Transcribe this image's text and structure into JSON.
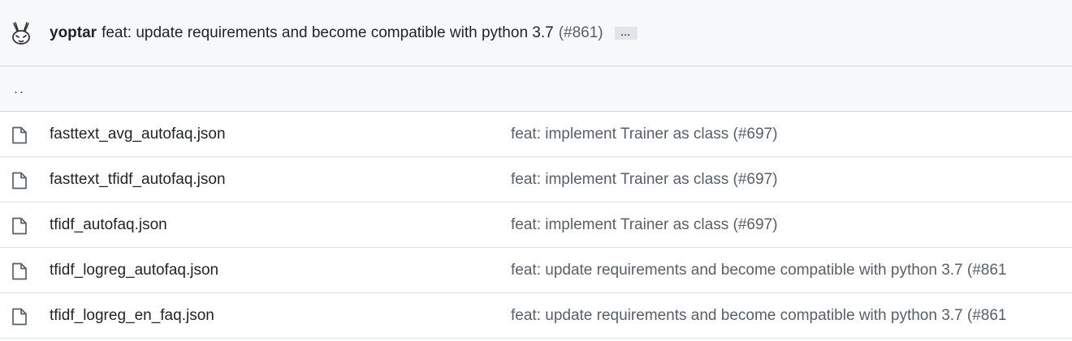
{
  "commit": {
    "author": "yoptar",
    "message": "feat: update requirements and become compatible with python 3.7",
    "pr": "(#861)",
    "more_label": "..."
  },
  "parent": {
    "label": ".."
  },
  "files": [
    {
      "icon": "file-icon",
      "name": "fasttext_avg_autofaq.json",
      "commit": "feat: implement Trainer as class (#697)"
    },
    {
      "icon": "file-icon",
      "name": "fasttext_tfidf_autofaq.json",
      "commit": "feat: implement Trainer as class (#697)"
    },
    {
      "icon": "file-icon",
      "name": "tfidf_autofaq.json",
      "commit": "feat: implement Trainer as class (#697)"
    },
    {
      "icon": "file-icon",
      "name": "tfidf_logreg_autofaq.json",
      "commit": "feat: update requirements and become compatible with python 3.7 (#861"
    },
    {
      "icon": "file-icon",
      "name": "tfidf_logreg_en_faq.json",
      "commit": "feat: update requirements and become compatible with python 3.7 (#861"
    }
  ]
}
